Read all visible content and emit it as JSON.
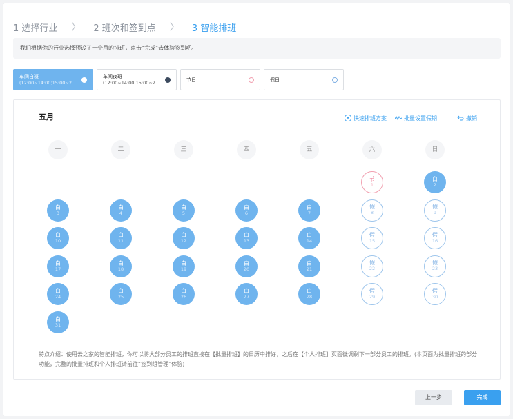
{
  "steps": [
    {
      "label": "1 选择行业"
    },
    {
      "label": "2 班次和签到点"
    },
    {
      "label": "3 智能排班"
    }
  ],
  "notice": "我们根据你的行业选择预设了一个月的排班，点击“完成”去体验签到吧。",
  "shifts": [
    {
      "name": "车间白班",
      "time": "(12:00~14:00;15:00~2...",
      "dot_color": "#ffffff"
    },
    {
      "name": "车间夜班",
      "time": "(12:00~14:00;15:00~2...",
      "dot_color": "#3c4a5e"
    },
    {
      "name": "节日",
      "dot_color": "#f1a0b0"
    },
    {
      "name": "假日",
      "dot_color": "#7fb0e4"
    }
  ],
  "calendar": {
    "month": "五月",
    "actions": [
      "快速排班方案",
      "批量设置假期",
      "撤销"
    ],
    "weekdays": [
      "一",
      "二",
      "三",
      "四",
      "五",
      "六",
      "日"
    ],
    "days": [
      {
        "col": 5,
        "row": 0,
        "label": "节",
        "num": "1",
        "kind": "hol"
      },
      {
        "col": 6,
        "row": 0,
        "label": "白",
        "num": "2",
        "kind": "work"
      },
      {
        "col": 0,
        "row": 1,
        "label": "白",
        "num": "3",
        "kind": "work"
      },
      {
        "col": 1,
        "row": 1,
        "label": "白",
        "num": "4",
        "kind": "work"
      },
      {
        "col": 2,
        "row": 1,
        "label": "白",
        "num": "5",
        "kind": "work"
      },
      {
        "col": 3,
        "row": 1,
        "label": "白",
        "num": "6",
        "kind": "work"
      },
      {
        "col": 4,
        "row": 1,
        "label": "白",
        "num": "7",
        "kind": "work"
      },
      {
        "col": 5,
        "row": 1,
        "label": "假",
        "num": "8",
        "kind": "rest"
      },
      {
        "col": 6,
        "row": 1,
        "label": "假",
        "num": "9",
        "kind": "rest"
      },
      {
        "col": 0,
        "row": 2,
        "label": "白",
        "num": "10",
        "kind": "work"
      },
      {
        "col": 1,
        "row": 2,
        "label": "白",
        "num": "11",
        "kind": "work"
      },
      {
        "col": 2,
        "row": 2,
        "label": "白",
        "num": "12",
        "kind": "work"
      },
      {
        "col": 3,
        "row": 2,
        "label": "白",
        "num": "13",
        "kind": "work"
      },
      {
        "col": 4,
        "row": 2,
        "label": "白",
        "num": "14",
        "kind": "work"
      },
      {
        "col": 5,
        "row": 2,
        "label": "假",
        "num": "15",
        "kind": "rest"
      },
      {
        "col": 6,
        "row": 2,
        "label": "假",
        "num": "16",
        "kind": "rest"
      },
      {
        "col": 0,
        "row": 3,
        "label": "白",
        "num": "17",
        "kind": "work"
      },
      {
        "col": 1,
        "row": 3,
        "label": "白",
        "num": "18",
        "kind": "work"
      },
      {
        "col": 2,
        "row": 3,
        "label": "白",
        "num": "19",
        "kind": "work"
      },
      {
        "col": 3,
        "row": 3,
        "label": "白",
        "num": "20",
        "kind": "work"
      },
      {
        "col": 4,
        "row": 3,
        "label": "白",
        "num": "21",
        "kind": "work"
      },
      {
        "col": 5,
        "row": 3,
        "label": "假",
        "num": "22",
        "kind": "rest"
      },
      {
        "col": 6,
        "row": 3,
        "label": "假",
        "num": "23",
        "kind": "rest"
      },
      {
        "col": 0,
        "row": 4,
        "label": "白",
        "num": "24",
        "kind": "work"
      },
      {
        "col": 1,
        "row": 4,
        "label": "白",
        "num": "25",
        "kind": "work"
      },
      {
        "col": 2,
        "row": 4,
        "label": "白",
        "num": "26",
        "kind": "work"
      },
      {
        "col": 3,
        "row": 4,
        "label": "白",
        "num": "27",
        "kind": "work"
      },
      {
        "col": 4,
        "row": 4,
        "label": "白",
        "num": "28",
        "kind": "work"
      },
      {
        "col": 5,
        "row": 4,
        "label": "假",
        "num": "29",
        "kind": "rest"
      },
      {
        "col": 6,
        "row": 4,
        "label": "假",
        "num": "30",
        "kind": "rest"
      },
      {
        "col": 0,
        "row": 5,
        "label": "白",
        "num": "31",
        "kind": "work"
      }
    ]
  },
  "note": "特点介绍：使用云之家的智能排班，你可以将大部分员工的排班直接在【批量排班】的日历中排好，之后在【个人排班】页面微调剩下一部分员工的排班。(本页面为批量排班的部分功能，完整的批量排班和个人排班请前往“签到组管理”体验)",
  "footer": {
    "prev": "上一步",
    "done": "完成"
  }
}
